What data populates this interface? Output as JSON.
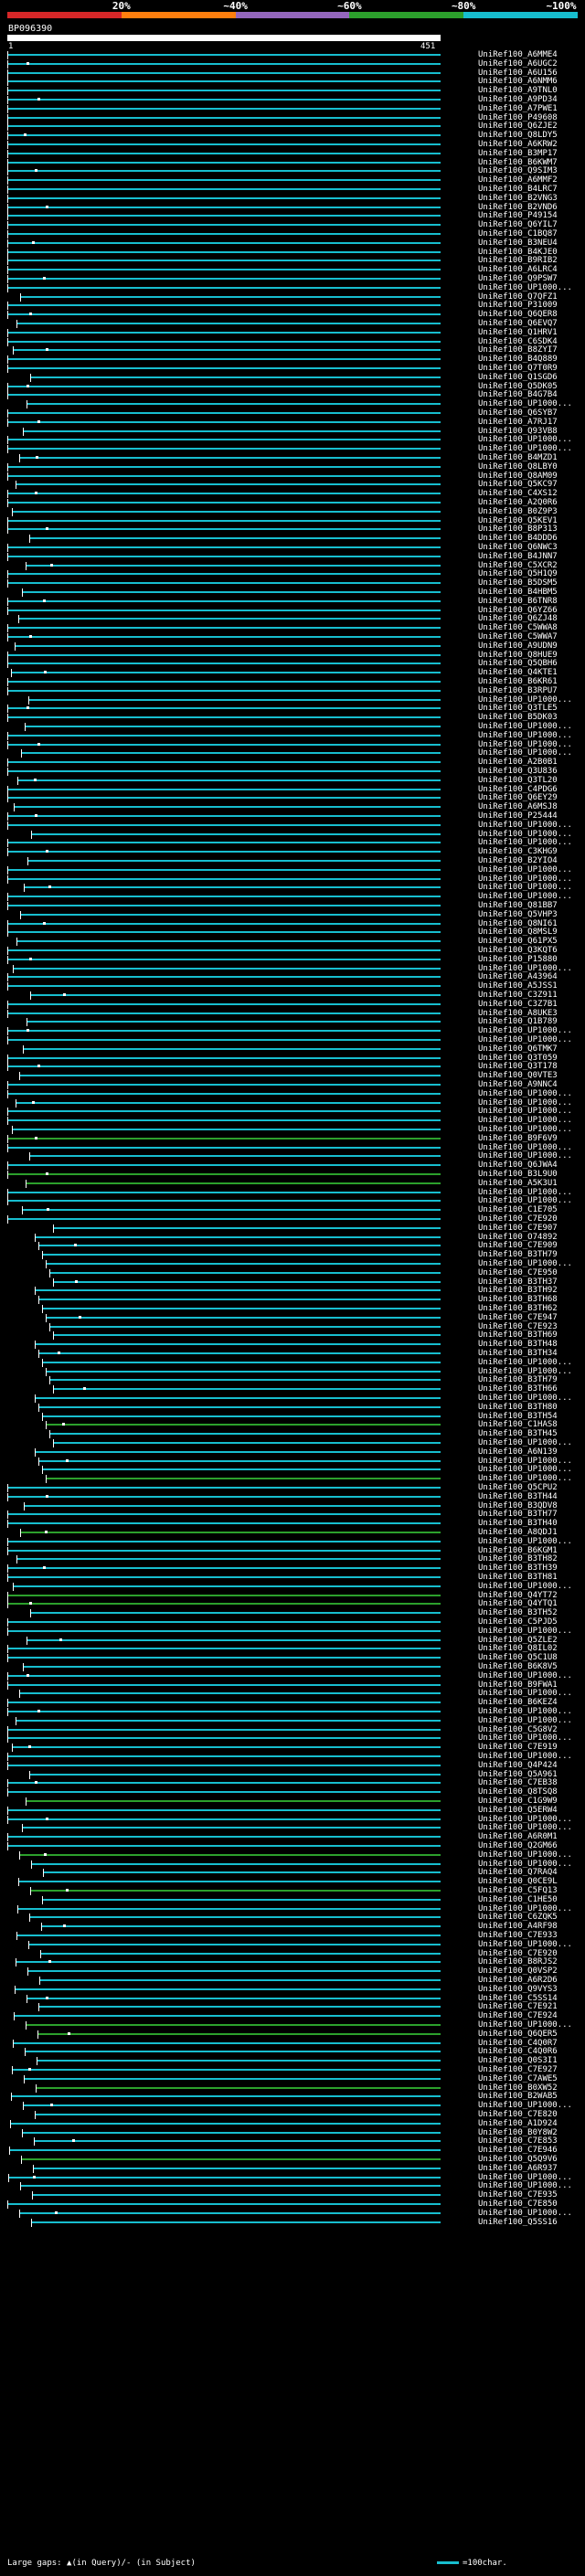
{
  "legend": {
    "labels": [
      "20%",
      "~40%",
      "~60%",
      "~80%",
      "~100%"
    ],
    "colors": [
      "#d62728",
      "#ff7f0e",
      "#9467bd",
      "#2ca02c",
      "#17becf"
    ]
  },
  "query": {
    "name": "BP096390",
    "start": "1",
    "end": "451"
  },
  "hits": [
    {
      "id": "UniRef100_A6MME4",
      "color": "#17becf"
    },
    {
      "id": "UniRef100_A6UGC2",
      "color": "#17becf"
    },
    {
      "id": "UniRef100_A6U156",
      "color": "#17becf"
    },
    {
      "id": "UniRef100_A6NMM6",
      "color": "#17becf"
    },
    {
      "id": "UniRef100_A9TNL0",
      "color": "#17becf"
    },
    {
      "id": "UniRef100_A9PD34",
      "color": "#17becf"
    },
    {
      "id": "UniRef100_A7PWE1",
      "color": "#17becf"
    },
    {
      "id": "UniRef100_P49608",
      "color": "#17becf"
    },
    {
      "id": "UniRef100_Q6ZJE2",
      "color": "#17becf"
    },
    {
      "id": "UniRef100_Q8LDY5",
      "color": "#17becf"
    },
    {
      "id": "UniRef100_A6KRW2",
      "color": "#17becf"
    },
    {
      "id": "UniRef100_B3MP17",
      "color": "#17becf"
    },
    {
      "id": "UniRef100_B6KWM7",
      "color": "#17becf"
    },
    {
      "id": "UniRef100_Q9SIM3",
      "color": "#17becf"
    },
    {
      "id": "UniRef100_A6MMF2",
      "color": "#17becf"
    },
    {
      "id": "UniRef100_B4LRC7",
      "color": "#17becf"
    },
    {
      "id": "UniRef100_B2VNG3",
      "color": "#17becf"
    },
    {
      "id": "UniRef100_B2VND6",
      "color": "#17becf"
    },
    {
      "id": "UniRef100_P49154",
      "color": "#17becf"
    },
    {
      "id": "UniRef100_Q6YIL7",
      "color": "#17becf"
    },
    {
      "id": "UniRef100_C1BQ87",
      "color": "#17becf"
    },
    {
      "id": "UniRef100_B3NEU4",
      "color": "#17becf"
    },
    {
      "id": "UniRef100_B4KJE0",
      "color": "#17becf"
    },
    {
      "id": "UniRef100_B9RIB2",
      "color": "#17becf"
    },
    {
      "id": "UniRef100_A6LRC4",
      "color": "#17becf"
    },
    {
      "id": "UniRef100_Q9PSW7",
      "color": "#17becf"
    },
    {
      "id": "UniRef100_UP1000...",
      "color": "#17becf"
    },
    {
      "id": "UniRef100_Q7QFZ1",
      "color": "#17becf"
    },
    {
      "id": "UniRef100_P31009",
      "color": "#17becf"
    },
    {
      "id": "UniRef100_Q6QER8",
      "color": "#17becf"
    },
    {
      "id": "UniRef100_Q6EVQ7",
      "color": "#17becf"
    },
    {
      "id": "UniRef100_Q1HRV1",
      "color": "#17becf"
    },
    {
      "id": "UniRef100_C6SDK4",
      "color": "#17becf"
    },
    {
      "id": "UniRef100_B8ZYI7",
      "color": "#17becf"
    },
    {
      "id": "UniRef100_B4Q889",
      "color": "#17becf"
    },
    {
      "id": "UniRef100_Q7T0R9",
      "color": "#17becf"
    },
    {
      "id": "UniRef100_Q1SGD6",
      "color": "#17becf"
    },
    {
      "id": "UniRef100_Q5DK05",
      "color": "#17becf"
    },
    {
      "id": "UniRef100_B4G7B4",
      "color": "#17becf"
    },
    {
      "id": "UniRef100_UP1000...",
      "color": "#17becf"
    },
    {
      "id": "UniRef100_Q6SYB7",
      "color": "#17becf"
    },
    {
      "id": "UniRef100_A7RJ17",
      "color": "#17becf"
    },
    {
      "id": "UniRef100_Q93VB8",
      "color": "#17becf"
    },
    {
      "id": "UniRef100_UP1000...",
      "color": "#17becf"
    },
    {
      "id": "UniRef100_UP1000...",
      "color": "#17becf"
    },
    {
      "id": "UniRef100_B4MZD1",
      "color": "#17becf"
    },
    {
      "id": "UniRef100_Q8LBY0",
      "color": "#17becf"
    },
    {
      "id": "UniRef100_Q8AM09",
      "color": "#17becf"
    },
    {
      "id": "UniRef100_Q5KC97",
      "color": "#17becf"
    },
    {
      "id": "UniRef100_C4XS12",
      "color": "#17becf"
    },
    {
      "id": "UniRef100_A2Q0R6",
      "color": "#17becf"
    },
    {
      "id": "UniRef100_B0Z9P3",
      "color": "#17becf"
    },
    {
      "id": "UniRef100_Q5KEV1",
      "color": "#17becf"
    },
    {
      "id": "UniRef100_B8P313",
      "color": "#17becf"
    },
    {
      "id": "UniRef100_B4DDD6",
      "color": "#17becf"
    },
    {
      "id": "UniRef100_Q6NWC3",
      "color": "#17becf"
    },
    {
      "id": "UniRef100_B4JNN7",
      "color": "#17becf"
    },
    {
      "id": "UniRef100_C5XCR2",
      "color": "#17becf"
    },
    {
      "id": "UniRef100_Q5H1Q9",
      "color": "#17becf"
    },
    {
      "id": "UniRef100_B5DSM5",
      "color": "#17becf"
    },
    {
      "id": "UniRef100_B4HBM5",
      "color": "#17becf"
    },
    {
      "id": "UniRef100_B6TNR8",
      "color": "#17becf"
    },
    {
      "id": "UniRef100_Q6YZ66",
      "color": "#17becf"
    },
    {
      "id": "UniRef100_Q6ZJ48",
      "color": "#17becf"
    },
    {
      "id": "UniRef100_C5WWA8",
      "color": "#17becf"
    },
    {
      "id": "UniRef100_C5WWA7",
      "color": "#17becf"
    },
    {
      "id": "UniRef100_A9UDN9",
      "color": "#17becf"
    },
    {
      "id": "UniRef100_Q8HUE9",
      "color": "#17becf"
    },
    {
      "id": "UniRef100_Q5QBH6",
      "color": "#17becf"
    },
    {
      "id": "UniRef100_Q4KTE1",
      "color": "#17becf"
    },
    {
      "id": "UniRef100_B6KR61",
      "color": "#17becf"
    },
    {
      "id": "UniRef100_B3RPU7",
      "color": "#17becf"
    },
    {
      "id": "UniRef100_UP1000...",
      "color": "#17becf"
    },
    {
      "id": "UniRef100_Q3TLE5",
      "color": "#17becf"
    },
    {
      "id": "UniRef100_B5DK03",
      "color": "#17becf"
    },
    {
      "id": "UniRef100_UP1000...",
      "color": "#17becf"
    },
    {
      "id": "UniRef100_UP1000...",
      "color": "#17becf"
    },
    {
      "id": "UniRef100_UP1000...",
      "color": "#17becf"
    },
    {
      "id": "UniRef100_UP1000...",
      "color": "#17becf"
    },
    {
      "id": "UniRef100_A2B0B1",
      "color": "#17becf"
    },
    {
      "id": "UniRef100_Q3U836",
      "color": "#17becf"
    },
    {
      "id": "UniRef100_Q3TL20",
      "color": "#17becf"
    },
    {
      "id": "UniRef100_C4PDG6",
      "color": "#17becf"
    },
    {
      "id": "UniRef100_Q6EY29",
      "color": "#17becf"
    },
    {
      "id": "UniRef100_A6MSJ8",
      "color": "#17becf"
    },
    {
      "id": "UniRef100_P25444",
      "color": "#17becf"
    },
    {
      "id": "UniRef100_UP1000...",
      "color": "#17becf"
    },
    {
      "id": "UniRef100_UP1000...",
      "color": "#17becf"
    },
    {
      "id": "UniRef100_UP1000...",
      "color": "#17becf"
    },
    {
      "id": "UniRef100_C3KHG9",
      "color": "#17becf"
    },
    {
      "id": "UniRef100_B2YIO4",
      "color": "#17becf"
    },
    {
      "id": "UniRef100_UP1000...",
      "color": "#17becf"
    },
    {
      "id": "UniRef100_UP1000...",
      "color": "#17becf"
    },
    {
      "id": "UniRef100_UP1000...",
      "color": "#17becf"
    },
    {
      "id": "UniRef100_UP1000...",
      "color": "#17becf"
    },
    {
      "id": "UniRef100_Q81BB7",
      "color": "#17becf"
    },
    {
      "id": "UniRef100_Q5VHP3",
      "color": "#17becf"
    },
    {
      "id": "UniRef100_Q8NI61",
      "color": "#17becf"
    },
    {
      "id": "UniRef100_Q8MSL9",
      "color": "#17becf"
    },
    {
      "id": "UniRef100_Q61PX5",
      "color": "#17becf"
    },
    {
      "id": "UniRef100_Q3KQT6",
      "color": "#17becf"
    },
    {
      "id": "UniRef100_P15880",
      "color": "#17becf"
    },
    {
      "id": "UniRef100_UP1000...",
      "color": "#17becf"
    },
    {
      "id": "UniRef100_A43964",
      "color": "#17becf"
    },
    {
      "id": "UniRef100_A5JSS1",
      "color": "#17becf"
    },
    {
      "id": "UniRef100_C3Z911",
      "color": "#17becf"
    },
    {
      "id": "UniRef100_C3Z7B1",
      "color": "#17becf"
    },
    {
      "id": "UniRef100_A8UKE3",
      "color": "#17becf"
    },
    {
      "id": "UniRef100_Q1B789",
      "color": "#17becf"
    },
    {
      "id": "UniRef100_UP1000...",
      "color": "#17becf"
    },
    {
      "id": "UniRef100_UP1000...",
      "color": "#17becf"
    },
    {
      "id": "UniRef100_Q6TMK7",
      "color": "#17becf"
    },
    {
      "id": "UniRef100_Q3T059",
      "color": "#17becf"
    },
    {
      "id": "UniRef100_Q3T178",
      "color": "#17becf"
    },
    {
      "id": "UniRef100_Q0VTE3",
      "color": "#17becf"
    },
    {
      "id": "UniRef100_A9NNC4",
      "color": "#17becf"
    },
    {
      "id": "UniRef100_UP1000...",
      "color": "#17becf"
    },
    {
      "id": "UniRef100_UP1000...",
      "color": "#17becf"
    },
    {
      "id": "UniRef100_UP1000...",
      "color": "#17becf"
    },
    {
      "id": "UniRef100_UP1000...",
      "color": "#17becf"
    },
    {
      "id": "UniRef100_UP1000...",
      "color": "#17becf"
    },
    {
      "id": "UniRef100_B9F6V9",
      "color": "#2ca02c"
    },
    {
      "id": "UniRef100_UP1000...",
      "color": "#17becf"
    },
    {
      "id": "UniRef100_UP1000...",
      "color": "#17becf"
    },
    {
      "id": "UniRef100_Q6JWA4",
      "color": "#17becf"
    },
    {
      "id": "UniRef100_B3L9U0",
      "color": "#2ca02c"
    },
    {
      "id": "UniRef100_A5K3U1",
      "color": "#2ca02c"
    },
    {
      "id": "UniRef100_UP1000...",
      "color": "#17becf"
    },
    {
      "id": "UniRef100_UP1000...",
      "color": "#17becf"
    },
    {
      "id": "UniRef100_C1E705",
      "color": "#17becf"
    },
    {
      "id": "UniRef100_C7E920",
      "color": "#17becf"
    },
    {
      "id": "UniRef100_C7E907",
      "color": "#17becf"
    },
    {
      "id": "UniRef100_O74892",
      "color": "#17becf"
    },
    {
      "id": "UniRef100_C7E909",
      "color": "#17becf"
    },
    {
      "id": "UniRef100_B3TH79",
      "color": "#17becf"
    },
    {
      "id": "UniRef100_UP1000...",
      "color": "#17becf"
    },
    {
      "id": "UniRef100_C7E950",
      "color": "#17becf"
    },
    {
      "id": "UniRef100_B3TH37",
      "color": "#17becf"
    },
    {
      "id": "UniRef100_B3TH92",
      "color": "#17becf"
    },
    {
      "id": "UniRef100_B3TH68",
      "color": "#17becf"
    },
    {
      "id": "UniRef100_B3TH62",
      "color": "#17becf"
    },
    {
      "id": "UniRef100_C7E947",
      "color": "#17becf"
    },
    {
      "id": "UniRef100_C7E923",
      "color": "#17becf"
    },
    {
      "id": "UniRef100_B3TH69",
      "color": "#17becf"
    },
    {
      "id": "UniRef100_B3TH48",
      "color": "#17becf"
    },
    {
      "id": "UniRef100_B3TH34",
      "color": "#17becf"
    },
    {
      "id": "UniRef100_UP1000...",
      "color": "#17becf"
    },
    {
      "id": "UniRef100_UP1000...",
      "color": "#17becf"
    },
    {
      "id": "UniRef100_B3TH79",
      "color": "#17becf"
    },
    {
      "id": "UniRef100_B3TH66",
      "color": "#17becf"
    },
    {
      "id": "UniRef100_UP1000...",
      "color": "#17becf"
    },
    {
      "id": "UniRef100_B3TH80",
      "color": "#17becf"
    },
    {
      "id": "UniRef100_B3TH54",
      "color": "#17becf"
    },
    {
      "id": "UniRef100_C1HAS8",
      "color": "#2ca02c"
    },
    {
      "id": "UniRef100_B3TH45",
      "color": "#17becf"
    },
    {
      "id": "UniRef100_UP1000...",
      "color": "#17becf"
    },
    {
      "id": "UniRef100_A6N139",
      "color": "#17becf"
    },
    {
      "id": "UniRef100_UP1000...",
      "color": "#17becf"
    },
    {
      "id": "UniRef100_UP1000...",
      "color": "#17becf"
    },
    {
      "id": "UniRef100_UP1000...",
      "color": "#2ca02c"
    },
    {
      "id": "UniRef100_Q5CPU2",
      "color": "#17becf"
    },
    {
      "id": "UniRef100_B3TH44",
      "color": "#17becf"
    },
    {
      "id": "UniRef100_B3QDV8",
      "color": "#17becf"
    },
    {
      "id": "UniRef100_B3TH77",
      "color": "#17becf"
    },
    {
      "id": "UniRef100_B3TH40",
      "color": "#17becf"
    },
    {
      "id": "UniRef100_A8QDJ1",
      "color": "#2ca02c"
    },
    {
      "id": "UniRef100_UP1000...",
      "color": "#17becf"
    },
    {
      "id": "UniRef100_B6KGM1",
      "color": "#17becf"
    },
    {
      "id": "UniRef100_B3TH82",
      "color": "#17becf"
    },
    {
      "id": "UniRef100_B3TH39",
      "color": "#17becf"
    },
    {
      "id": "UniRef100_B3TH81",
      "color": "#17becf"
    },
    {
      "id": "UniRef100_UP1000...",
      "color": "#17becf"
    },
    {
      "id": "UniRef100_Q4YT72",
      "color": "#2ca02c"
    },
    {
      "id": "UniRef100_Q4YTQ1",
      "color": "#2ca02c"
    },
    {
      "id": "UniRef100_B3TH52",
      "color": "#17becf"
    },
    {
      "id": "UniRef100_C5PJD5",
      "color": "#17becf"
    },
    {
      "id": "UniRef100_UP1000...",
      "color": "#17becf"
    },
    {
      "id": "UniRef100_Q5ZLE2",
      "color": "#17becf"
    },
    {
      "id": "UniRef100_Q8IL02",
      "color": "#17becf"
    },
    {
      "id": "UniRef100_Q5C1U8",
      "color": "#17becf"
    },
    {
      "id": "UniRef100_B6K8V5",
      "color": "#17becf"
    },
    {
      "id": "UniRef100_UP1000...",
      "color": "#17becf"
    },
    {
      "id": "UniRef100_B9FWA1",
      "color": "#17becf"
    },
    {
      "id": "UniRef100_UP1000...",
      "color": "#17becf"
    },
    {
      "id": "UniRef100_B6KEZ4",
      "color": "#17becf"
    },
    {
      "id": "UniRef100_UP1000...",
      "color": "#17becf"
    },
    {
      "id": "UniRef100_UP1000...",
      "color": "#17becf"
    },
    {
      "id": "UniRef100_C5G8V2",
      "color": "#17becf"
    },
    {
      "id": "UniRef100_UP1000...",
      "color": "#17becf"
    },
    {
      "id": "UniRef100_C7E919",
      "color": "#17becf"
    },
    {
      "id": "UniRef100_UP1000...",
      "color": "#17becf"
    },
    {
      "id": "UniRef100_Q4P424",
      "color": "#17becf"
    },
    {
      "id": "UniRef100_Q5A961",
      "color": "#17becf"
    },
    {
      "id": "UniRef100_C7EB38",
      "color": "#17becf"
    },
    {
      "id": "UniRef100_Q8TSQ8",
      "color": "#17becf"
    },
    {
      "id": "UniRef100_C1G9W9",
      "color": "#2ca02c"
    },
    {
      "id": "UniRef100_Q5ERW4",
      "color": "#17becf"
    },
    {
      "id": "UniRef100_UP1000...",
      "color": "#17becf"
    },
    {
      "id": "UniRef100_UP1000...",
      "color": "#17becf"
    },
    {
      "id": "UniRef100_A6R0M1",
      "color": "#17becf"
    },
    {
      "id": "UniRef100_Q2GM66",
      "color": "#17becf"
    },
    {
      "id": "UniRef100_UP1000...",
      "color": "#2ca02c"
    },
    {
      "id": "UniRef100_UP1000...",
      "color": "#17becf"
    },
    {
      "id": "UniRef100_Q7RAQ4",
      "color": "#17becf"
    },
    {
      "id": "UniRef100_Q0CE9L",
      "color": "#17becf"
    },
    {
      "id": "UniRef100_C5FQ13",
      "color": "#2ca02c"
    },
    {
      "id": "UniRef100_C1HE50",
      "color": "#17becf"
    },
    {
      "id": "UniRef100_UP1000...",
      "color": "#17becf"
    },
    {
      "id": "UniRef100_C6ZQK5",
      "color": "#17becf"
    },
    {
      "id": "UniRef100_A4RF98",
      "color": "#17becf"
    },
    {
      "id": "UniRef100_C7E933",
      "color": "#17becf"
    },
    {
      "id": "UniRef100_UP1000...",
      "color": "#17becf"
    },
    {
      "id": "UniRef100_C7E920",
      "color": "#17becf"
    },
    {
      "id": "UniRef100_B8RJS2",
      "color": "#17becf"
    },
    {
      "id": "UniRef100_Q0VSP2",
      "color": "#17becf"
    },
    {
      "id": "UniRef100_A6R2D6",
      "color": "#17becf"
    },
    {
      "id": "UniRef100_Q9VYS3",
      "color": "#17becf"
    },
    {
      "id": "UniRef100_C5SS14",
      "color": "#17becf"
    },
    {
      "id": "UniRef100_C7E921",
      "color": "#17becf"
    },
    {
      "id": "UniRef100_C7E924",
      "color": "#17becf"
    },
    {
      "id": "UniRef100_UP1000...",
      "color": "#2ca02c"
    },
    {
      "id": "UniRef100_Q6QER5",
      "color": "#2ca02c"
    },
    {
      "id": "UniRef100_C4Q0R7",
      "color": "#17becf"
    },
    {
      "id": "UniRef100_C4Q0R6",
      "color": "#17becf"
    },
    {
      "id": "UniRef100_Q0S3I1",
      "color": "#17becf"
    },
    {
      "id": "UniRef100_C7E927",
      "color": "#17becf"
    },
    {
      "id": "UniRef100_C7AWE5",
      "color": "#17becf"
    },
    {
      "id": "UniRef100_B0XW52",
      "color": "#2ca02c"
    },
    {
      "id": "UniRef100_B2WAB5",
      "color": "#17becf"
    },
    {
      "id": "UniRef100_UP1000...",
      "color": "#17becf"
    },
    {
      "id": "UniRef100_C7E820",
      "color": "#17becf"
    },
    {
      "id": "UniRef100_A1D924",
      "color": "#17becf"
    },
    {
      "id": "UniRef100_B0Y8W2",
      "color": "#17becf"
    },
    {
      "id": "UniRef100_C7E853",
      "color": "#17becf"
    },
    {
      "id": "UniRef100_C7E946",
      "color": "#17becf"
    },
    {
      "id": "UniRef100_Q5Q9V6",
      "color": "#2ca02c"
    },
    {
      "id": "UniRef100_A6R937",
      "color": "#17becf"
    },
    {
      "id": "UniRef100_UP1000...",
      "color": "#17becf"
    },
    {
      "id": "UniRef100_UP1000...",
      "color": "#17becf"
    },
    {
      "id": "UniRef100_C7E935",
      "color": "#17becf"
    },
    {
      "id": "UniRef100_C7E850",
      "color": "#17becf"
    },
    {
      "id": "UniRef100_UP1000...",
      "color": "#17becf"
    },
    {
      "id": "UniRef100_Q5SS16",
      "color": "#17becf"
    }
  ],
  "footer": {
    "gaps_text": "Large gaps: ▲(in Query)/- (in Subject)",
    "scale_text": "=100char."
  }
}
